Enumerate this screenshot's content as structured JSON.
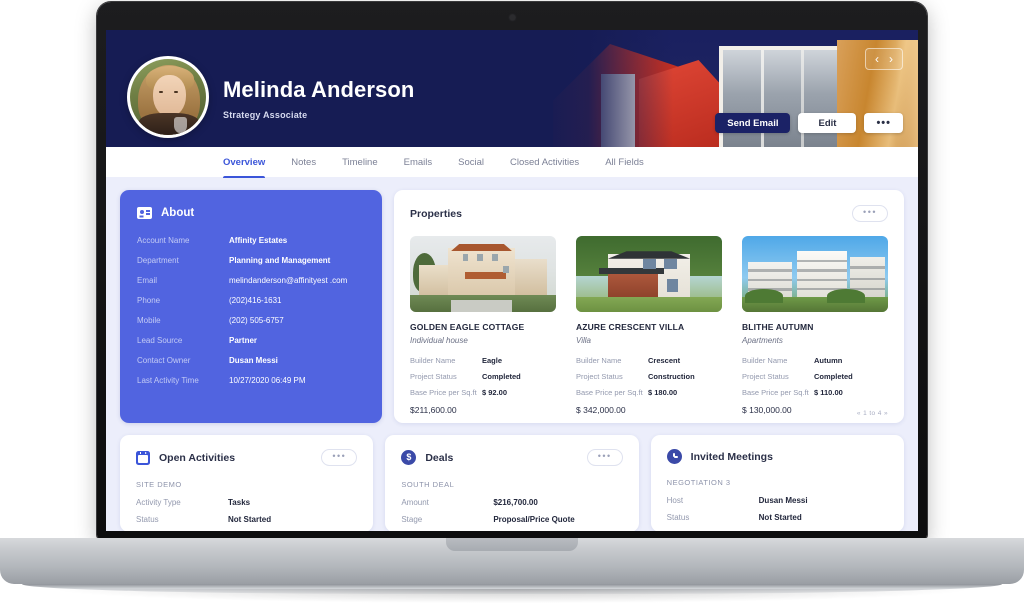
{
  "header": {
    "contact_name": "Melinda Anderson",
    "contact_title": "Strategy Associate",
    "nav_prev_icon": "chevron-left-icon",
    "nav_next_icon": "chevron-right-icon",
    "nav_prev": "‹",
    "nav_next": "›",
    "actions": {
      "send_email": "Send Email",
      "edit": "Edit",
      "more": "•••"
    },
    "navy_color": "#161C54"
  },
  "tabs": [
    {
      "label": "Overview",
      "active": true
    },
    {
      "label": "Notes",
      "active": false
    },
    {
      "label": "Timeline",
      "active": false
    },
    {
      "label": "Emails",
      "active": false
    },
    {
      "label": "Social",
      "active": false
    },
    {
      "label": "Closed Activities",
      "active": false
    },
    {
      "label": "All Fields",
      "active": false
    }
  ],
  "about": {
    "title": "About",
    "icon": "id-card-icon",
    "accent_color": "#5164E0",
    "fields": [
      {
        "label": "Account Name",
        "value": "Affinity Estates"
      },
      {
        "label": "Department",
        "value": "Planning and Management"
      },
      {
        "label": "Email",
        "value": "melindanderson@affinityest .com"
      },
      {
        "label": "Phone",
        "value": "(202)416-1631"
      },
      {
        "label": "Mobile",
        "value": "(202) 505-6757"
      },
      {
        "label": "Lead Source",
        "value": "Partner"
      },
      {
        "label": "Contact Owner",
        "value": "Dusan Messi"
      },
      {
        "label": "Last Activity Time",
        "value": "10/27/2020   06:49 PM"
      }
    ]
  },
  "properties": {
    "title": "Properties",
    "more_label": "•••",
    "pager": "« 1 to 4 »",
    "items": [
      {
        "name": "GOLDEN EAGLE COTTAGE",
        "type": "Individual house",
        "photo": "mediterranean-villa-photo",
        "rows": [
          {
            "label": "Builder Name",
            "value": "Eagle"
          },
          {
            "label": "Project Status",
            "value": "Completed"
          },
          {
            "label": "Base Price per Sq.ft",
            "value": "$ 92.00"
          }
        ],
        "total": "$211,600.00"
      },
      {
        "name": "AZURE CRESCENT VILLA",
        "type": "Villa",
        "photo": "modern-brick-house-photo",
        "rows": [
          {
            "label": "Builder Name",
            "value": "Crescent"
          },
          {
            "label": "Project Status",
            "value": "Construction"
          },
          {
            "label": "Base Price per Sq.ft",
            "value": "$ 180.00"
          }
        ],
        "total": "$ 342,000.00"
      },
      {
        "name": "BLITHE AUTUMN",
        "type": "Apartments",
        "photo": "apartment-blocks-photo",
        "rows": [
          {
            "label": "Builder Name",
            "value": "Autumn"
          },
          {
            "label": "Project Status",
            "value": "Completed"
          },
          {
            "label": "Base Price per Sq.ft",
            "value": "$ 110.00"
          }
        ],
        "total": "$ 130,000.00"
      }
    ]
  },
  "bottom_cards": [
    {
      "title": "Open Activities",
      "icon": "calendar-icon",
      "more_label": "•••",
      "has_more": true,
      "subtitle": "SITE DEMO",
      "rows": [
        {
          "label": "Activity Type",
          "value": "Tasks"
        },
        {
          "label": "Status",
          "value": "Not Started"
        }
      ]
    },
    {
      "title": "Deals",
      "icon": "dollar-circle-icon",
      "more_label": "•••",
      "has_more": true,
      "subtitle": "SOUTH DEAL",
      "rows": [
        {
          "label": "Amount",
          "value": "$216,700.00"
        },
        {
          "label": "Stage",
          "value": "Proposal/Price Quote"
        }
      ]
    },
    {
      "title": "Invited Meetings",
      "icon": "clock-icon",
      "more_label": "•••",
      "has_more": false,
      "subtitle": "NEGOTIATION 3",
      "rows": [
        {
          "label": "Host",
          "value": "Dusan Messi"
        },
        {
          "label": "Status",
          "value": "Not Started"
        }
      ]
    }
  ]
}
